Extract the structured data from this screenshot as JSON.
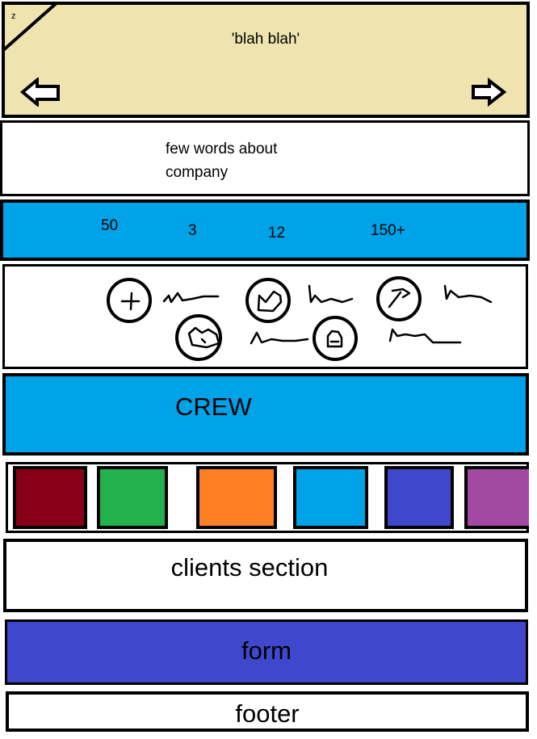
{
  "hero": {
    "corner_label": "z",
    "title": "'blah blah'",
    "prev_icon": "arrow-left-icon",
    "next_icon": "arrow-right-icon"
  },
  "about": {
    "line1": "few words about",
    "line2": "company"
  },
  "stats": {
    "items": [
      "50",
      "3",
      "12",
      "150+"
    ]
  },
  "services": {
    "icons": [
      "plus-icon",
      "heart-icon",
      "hammer-icon",
      "heart-icon",
      "lock-icon"
    ]
  },
  "crew": {
    "title": "CREW"
  },
  "members": {
    "colors": [
      "#880015",
      "#22b14c",
      "#ff7f27",
      "#00a2e8",
      "#3f48cc",
      "#a349a4"
    ]
  },
  "clients": {
    "title": "clients section"
  },
  "form": {
    "title": "form"
  },
  "footer": {
    "title": "footer"
  },
  "palette": {
    "hero_bg": "#efe4b0",
    "accent_blue": "#00a2e8",
    "form_blue": "#3f48cc"
  }
}
